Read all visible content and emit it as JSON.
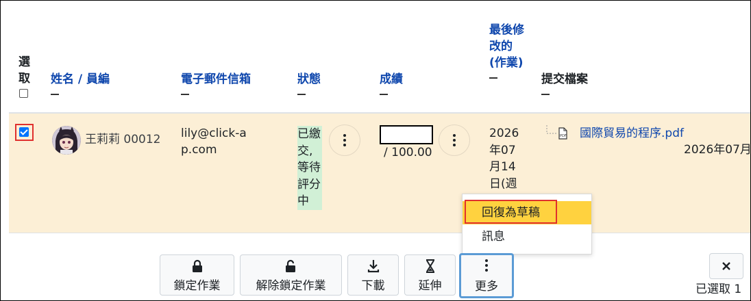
{
  "table": {
    "columns": {
      "select": "選取",
      "name": "姓名 / 員編",
      "email": "電子郵件信箱",
      "status": "狀態",
      "grade": "成績",
      "modified": "最後修改的(作業)",
      "files": "提交檔案"
    },
    "rows": [
      {
        "selected": true,
        "name": "王莉莉 00012",
        "email": "lily@click-ap.com",
        "status": "已繳交,等待評分中",
        "grade_value": "",
        "grade_max": "/ 100.00",
        "modified": "2026年07月14日(週",
        "file_name": "國際貿易的程序.pdf",
        "file_date": "2026年07月"
      }
    ]
  },
  "grade_menu": {
    "items": [
      "回復為草稿",
      "訊息"
    ],
    "highlighted": "回復為草稿"
  },
  "bulk_actions": {
    "lock": "鎖定作業",
    "unlock": "解除鎖定作業",
    "download": "下載",
    "extend": "延伸",
    "more": "更多",
    "selected_count": "已選取 1"
  },
  "colors": {
    "row_selected": "#fcefd6",
    "status_bg": "#d1f0d6",
    "menu_highlight": "#ffd23f",
    "focus_outline": "#e0302e",
    "link": "#0f47ad"
  }
}
